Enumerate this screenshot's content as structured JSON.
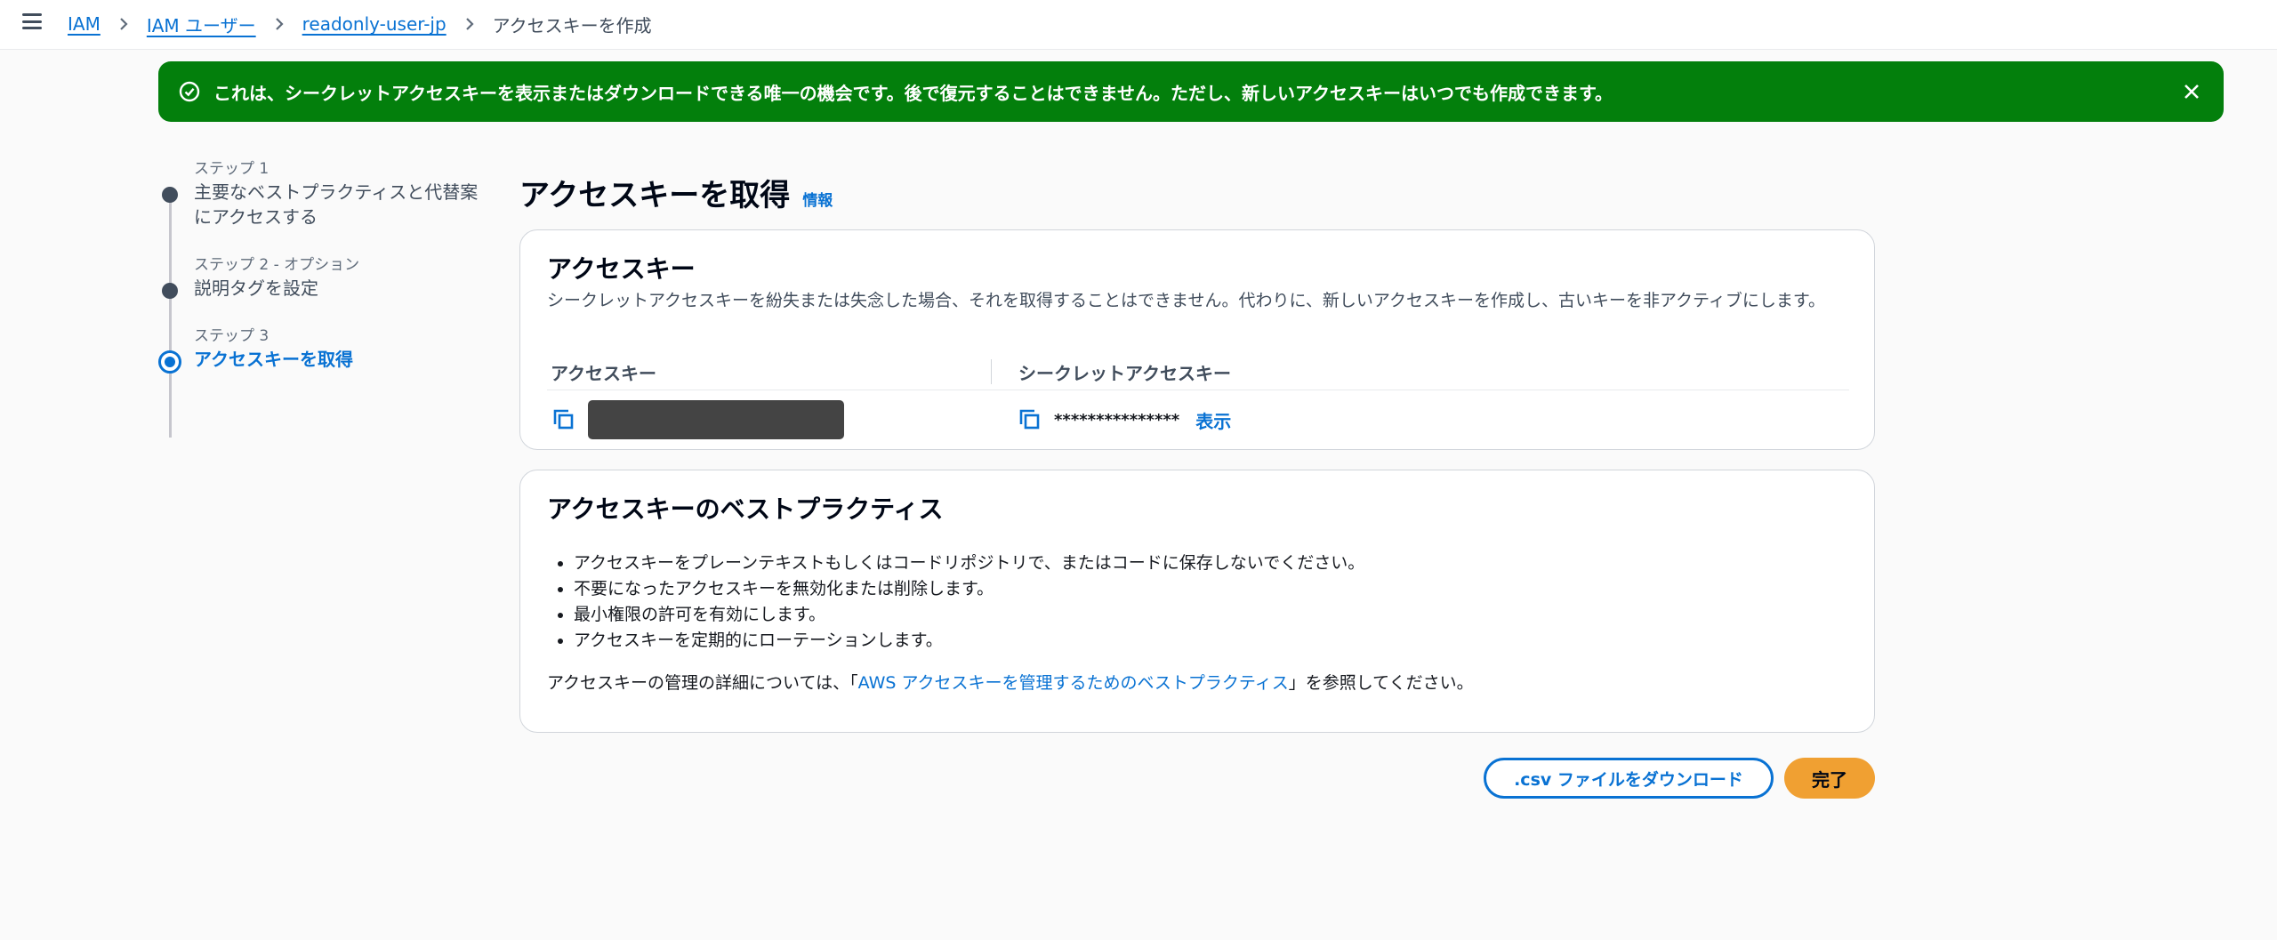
{
  "breadcrumb": {
    "items": [
      "IAM",
      "IAM ユーザー",
      "readonly-user-jp"
    ],
    "current": "アクセスキーを作成"
  },
  "flash": {
    "message": "これは、シークレットアクセスキーを表示またはダウンロードできる唯一の機会です。後で復元することはできません。ただし、新しいアクセスキーはいつでも作成できます。",
    "type": "success",
    "color": "#037f0c"
  },
  "steps": [
    {
      "num": "ステップ 1",
      "title": "主要なベストプラクティスと代替案にアクセスする",
      "state": "complete"
    },
    {
      "num": "ステップ 2 - オプション",
      "title": "説明タグを設定",
      "state": "complete"
    },
    {
      "num": "ステップ 3",
      "title": "アクセスキーを取得",
      "state": "active"
    }
  ],
  "page": {
    "title": "アクセスキーを取得",
    "info_link": "情報"
  },
  "access_keys": {
    "heading": "アクセスキー",
    "description": "シークレットアクセスキーを紛失または失念した場合、それを取得することはできません。代わりに、新しいアクセスキーを作成し、古いキーを非アクティブにします。",
    "col_access_key": "アクセスキー",
    "col_secret_key": "シークレットアクセスキー",
    "secret_masked": "***************",
    "show_label": "表示"
  },
  "best_practices": {
    "heading": "アクセスキーのベストプラクティス",
    "items": [
      "アクセスキーをプレーンテキストもしくはコードリポジトリで、またはコードに保存しないでください。",
      "不要になったアクセスキーを無効化または削除します。",
      "最小権限の許可を有効にします。",
      "アクセスキーを定期的にローテーションします。"
    ],
    "ref_prefix": "アクセスキーの管理の詳細については、「",
    "ref_link": "AWS アクセスキーを管理するためのベストプラクティス",
    "ref_suffix": "」を参照してください。"
  },
  "actions": {
    "download_label": ".csv ファイルをダウンロード",
    "done_label": "完了"
  },
  "colors": {
    "link": "#0972d3",
    "primary_button": "#f0a032"
  }
}
